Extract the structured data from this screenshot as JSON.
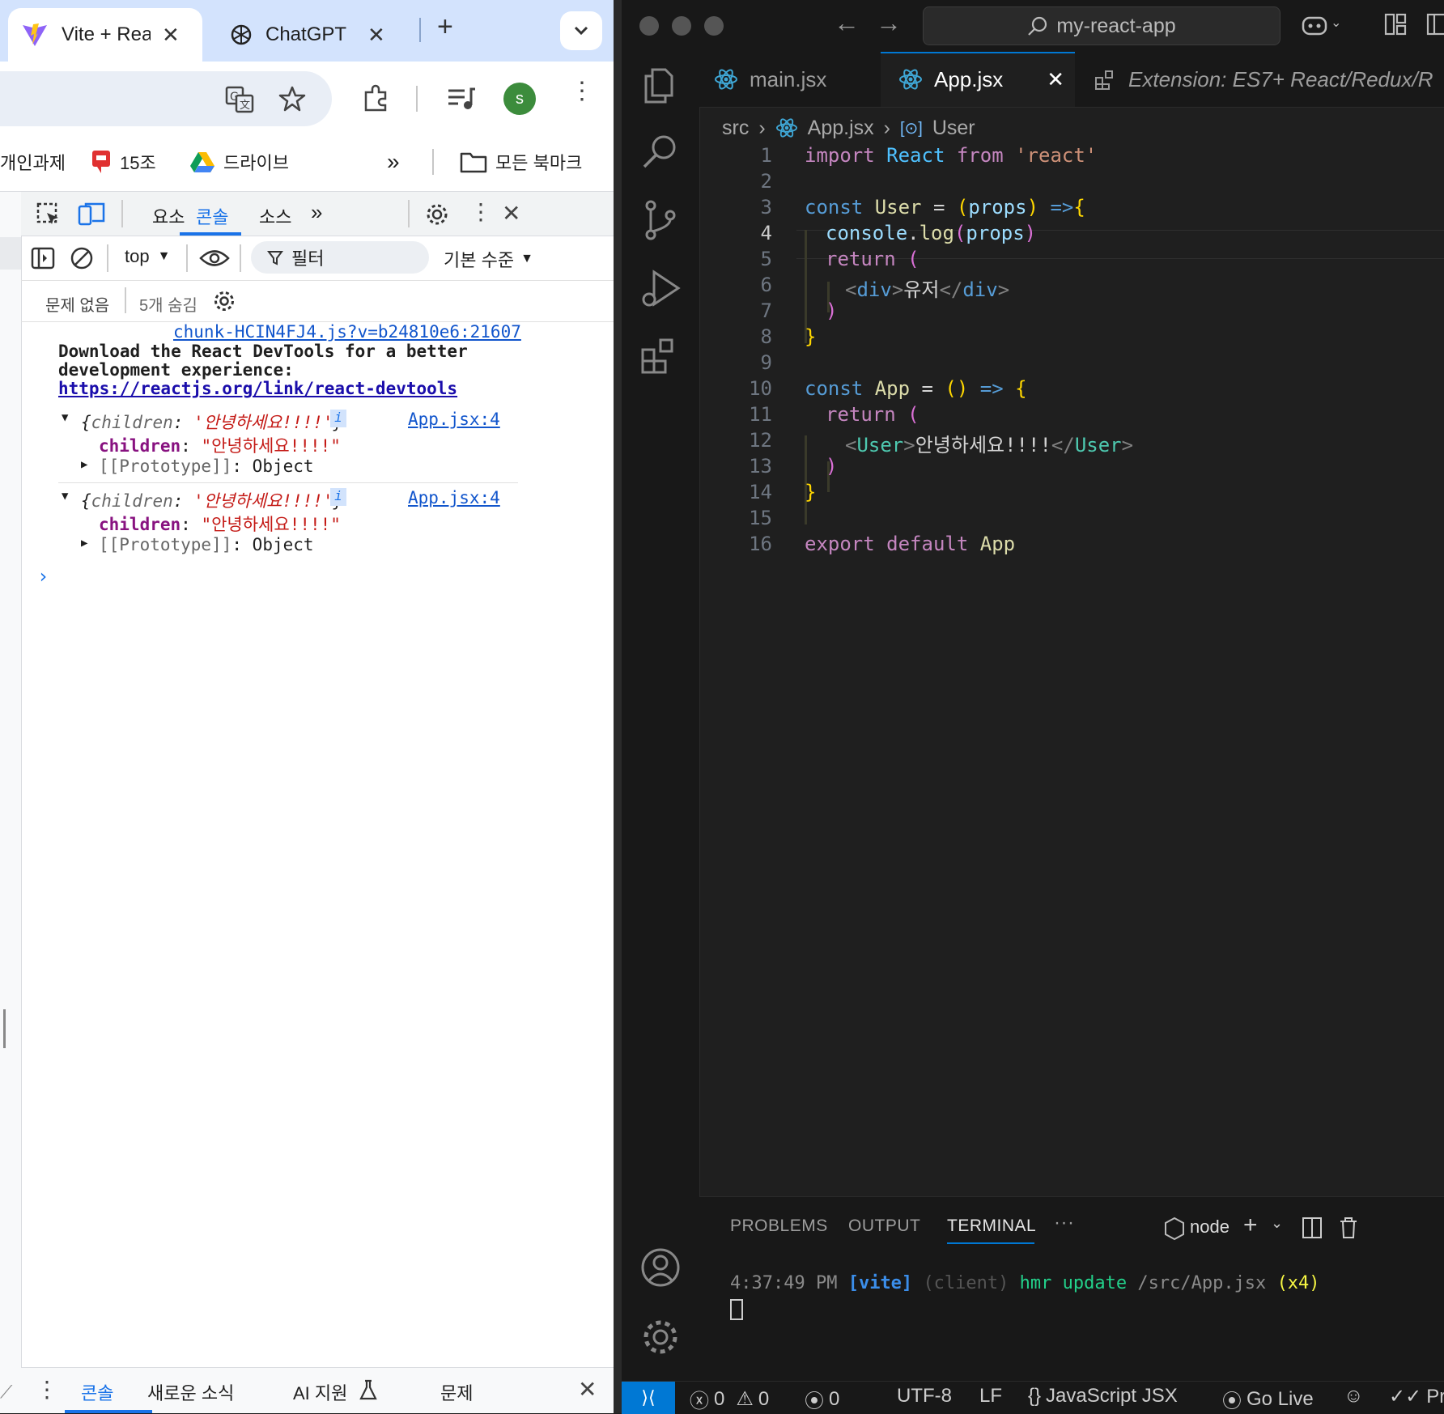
{
  "browser": {
    "tabs": [
      {
        "title": "Vite + Rea",
        "icon": "vite-logo"
      },
      {
        "title": "ChatGPT",
        "icon": "chatgpt-logo"
      }
    ],
    "new_tab": "+",
    "profile_initial": "s",
    "colors": {
      "tabstrip": "#d3e3fd",
      "profile": "#3c8c3c"
    },
    "bookmarks": [
      {
        "label": "개인과제",
        "icon": "none"
      },
      {
        "label": "15조",
        "icon": "bookmark-red-icon"
      },
      {
        "label": "드라이브",
        "icon": "google-drive-icon"
      }
    ],
    "all_bookmarks": "모든 북마크",
    "more_bookmarks": "»"
  },
  "devtools": {
    "tabs": [
      "요소",
      "콘솔",
      "소스"
    ],
    "active_tab": "콘솔",
    "context": "top",
    "filter_placeholder": "필터",
    "level": "기본 수준",
    "no_issues": "문제 없음",
    "hidden": "5개 숨김",
    "console": {
      "devtools_source": "chunk-HCIN4FJ4.js?v=b24810e6:21607",
      "devtools_msg_line1": "Download the React DevTools for a better",
      "devtools_msg_line2": "development experience:",
      "devtools_link": "https://reactjs.org/link/react-devtools",
      "entries": [
        {
          "summary_key": "children",
          "summary_value": "'안녕하세요!!!!'",
          "source": "App.jsx:4",
          "prop_key": "children",
          "prop_value": "\"안녕하세요!!!!\"",
          "proto_key": "[[Prototype]]",
          "proto_value": "Object"
        },
        {
          "summary_key": "children",
          "summary_value": "'안녕하세요!!!!'",
          "source": "App.jsx:4",
          "prop_key": "children",
          "prop_value": "\"안녕하세요!!!!\"",
          "proto_key": "[[Prototype]]",
          "proto_value": "Object"
        }
      ]
    },
    "drawer_tabs": [
      "콘솔",
      "새로운 소식",
      "AI 지원",
      "문제"
    ]
  },
  "vscode": {
    "search_title": "my-react-app",
    "tabs": [
      {
        "label": "main.jsx",
        "active": false
      },
      {
        "label": "App.jsx",
        "active": true
      },
      {
        "label": "Extension: ES7+ React/Redux/R",
        "active": false
      }
    ],
    "breadcrumb": [
      "src",
      "App.jsx",
      "User"
    ],
    "current_line": "4",
    "code_lines": [
      "1",
      "2",
      "3",
      "4",
      "5",
      "6",
      "7",
      "8",
      "9",
      "10",
      "11",
      "12",
      "13",
      "14",
      "15",
      "16"
    ],
    "code": {
      "l1": {
        "a": "import",
        "b": "React",
        "c": "from",
        "d": "'react'"
      },
      "l3": {
        "a": "const",
        "b": "User",
        "c": "=",
        "d": "(",
        "e": "props",
        "f": ")",
        "g": "=>",
        "h": "{"
      },
      "l4": {
        "a": "console",
        "b": ".",
        "c": "log",
        "d": "(",
        "e": "props",
        "f": ")"
      },
      "l5": {
        "a": "return",
        "b": "("
      },
      "l6": {
        "a": "<",
        "b": "div",
        "c": ">",
        "d": "유저",
        "e": "</",
        "f": "div",
        "g": ">"
      },
      "l7": {
        "a": ")"
      },
      "l8": {
        "a": "}"
      },
      "l10": {
        "a": "const",
        "b": "App",
        "c": "=",
        "d": "()",
        "e": "=>",
        "f": "{"
      },
      "l11": {
        "a": "return",
        "b": "("
      },
      "l12": {
        "a": "<",
        "b": "User",
        "c": ">",
        "d": "안녕하세요!!!!",
        "e": "</",
        "f": "User",
        "g": ">"
      },
      "l13": {
        "a": ")"
      },
      "l14": {
        "a": "}"
      },
      "l16": {
        "a": "export",
        "b": "default",
        "c": "App"
      }
    },
    "panel": {
      "tabs": [
        "PROBLEMS",
        "OUTPUT",
        "TERMINAL"
      ],
      "active": "TERMINAL",
      "more": "···",
      "shell": "node",
      "terminal": {
        "time": "4:37:49 PM",
        "vite": "[vite]",
        "client": "(client)",
        "msg": "hmr update",
        "path": "/src/App.jsx",
        "count": "(x4)"
      }
    },
    "status": {
      "errors": "0",
      "warnings": "0",
      "ports": "0",
      "encoding": "UTF-8",
      "eol": "LF",
      "language": "JavaScript JSX",
      "go_live": "Go Live",
      "prettier": "Pre"
    }
  }
}
